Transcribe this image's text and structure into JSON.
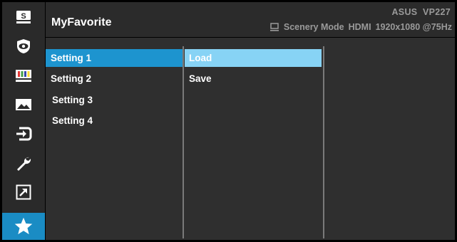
{
  "header": {
    "title": "MyFavorite",
    "model": "ASUS  VP227",
    "mode": "Scenery Mode",
    "input": "HDMI",
    "resolution": "1920x1080 @75Hz"
  },
  "sidebar": {
    "items": [
      {
        "icon": "splendid-icon",
        "label": "S",
        "active": false
      },
      {
        "icon": "eye-care-icon",
        "active": false
      },
      {
        "icon": "color-icon",
        "active": false
      },
      {
        "icon": "image-icon",
        "active": false
      },
      {
        "icon": "input-select-icon",
        "active": false
      },
      {
        "icon": "system-setup-icon",
        "active": false
      },
      {
        "icon": "shortcut-icon",
        "active": false
      },
      {
        "icon": "my-favorite-icon",
        "active": true
      }
    ]
  },
  "menu": {
    "items": [
      "Setting 1",
      "Setting 2",
      "Setting 3",
      "Setting 4"
    ],
    "selected": "Setting 1"
  },
  "submenu": {
    "items": [
      "Load",
      "Save"
    ],
    "selected": "Load"
  },
  "colors": {
    "active_icon_bg": "#1a8cc4",
    "menu_selected": "#1d94cf",
    "submenu_selected": "#87d3f5",
    "panel_bg": "#2f2f2f",
    "header_bg": "#2b2b2b",
    "muted_text": "#9a9a9a"
  }
}
